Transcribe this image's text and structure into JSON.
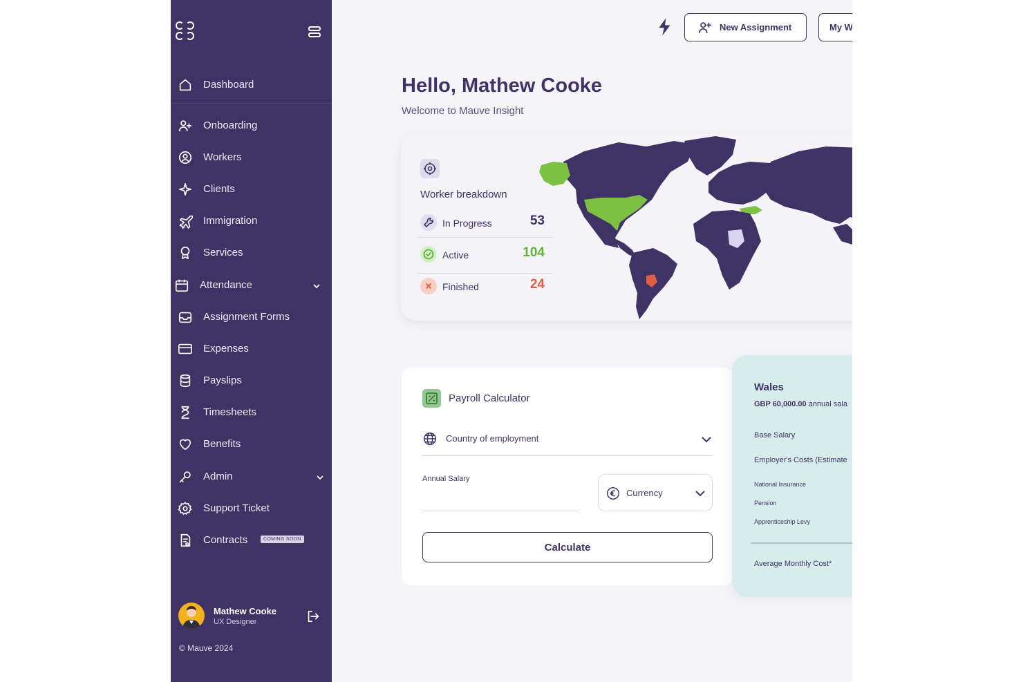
{
  "sidebar": {
    "items": [
      {
        "label": "Dashboard",
        "icon": "home-icon"
      },
      {
        "label": "Onboarding",
        "icon": "user-add-icon"
      },
      {
        "label": "Workers",
        "icon": "user-circle-icon"
      },
      {
        "label": "Clients",
        "icon": "sparkle-icon"
      },
      {
        "label": "Immigration",
        "icon": "plane-icon"
      },
      {
        "label": "Services",
        "icon": "award-icon"
      },
      {
        "label": "Attendance",
        "icon": "calendar-icon"
      },
      {
        "label": "Assignment Forms",
        "icon": "inbox-icon"
      },
      {
        "label": "Expenses",
        "icon": "credit-card-icon"
      },
      {
        "label": "Payslips",
        "icon": "database-icon"
      },
      {
        "label": "Timesheets",
        "icon": "hourglass-icon"
      },
      {
        "label": "Benefits",
        "icon": "heart-icon"
      },
      {
        "label": "Admin",
        "icon": "key-icon"
      },
      {
        "label": "Support Ticket",
        "icon": "gear-icon"
      },
      {
        "label": "Contracts",
        "icon": "document-icon",
        "badge": "COMING SOON"
      }
    ],
    "profile": {
      "name": "Mathew Cooke",
      "role": "UX Designer"
    },
    "copyright": "© Mauve 2024"
  },
  "topbar": {
    "new_assignment": "New Assignment",
    "my_button": "My W"
  },
  "header": {
    "greeting": "Hello, Mathew Cooke",
    "welcome": "Welcome to Mauve Insight"
  },
  "worker_breakdown": {
    "title": "Worker breakdown",
    "rows": [
      {
        "label": "In Progress",
        "value": "53",
        "color": "#3f3264"
      },
      {
        "label": "Active",
        "value": "104",
        "color": "#5fb23a"
      },
      {
        "label": "Finished",
        "value": "24",
        "color": "#e05d43"
      }
    ],
    "map_colors": {
      "land": "#3f3264",
      "highlight_green": "#7cc142",
      "highlight_red": "#e05d43",
      "highlight_light": "#d9d4f0"
    }
  },
  "payroll": {
    "title": "Payroll Calculator",
    "country_placeholder": "Country of employment",
    "salary_label": "Annual Salary",
    "currency_placeholder": "Currency",
    "calculate": "Calculate"
  },
  "wales": {
    "title": "Wales",
    "salary_amount": "GBP 60,000.00",
    "salary_suffix": " annual sala",
    "base_salary": "Base Salary",
    "employer_costs": "Employer's Costs (Estimate",
    "national_insurance": "National Insurance",
    "pension": "Pension",
    "apprenticeship_levy": "Apprenticeship Levy",
    "average_monthly": "Average Monthly Cost*"
  },
  "colors": {
    "sidebar_bg": "#3f3264",
    "accent": "#3f3264",
    "wales_bg": "#d6edec"
  }
}
